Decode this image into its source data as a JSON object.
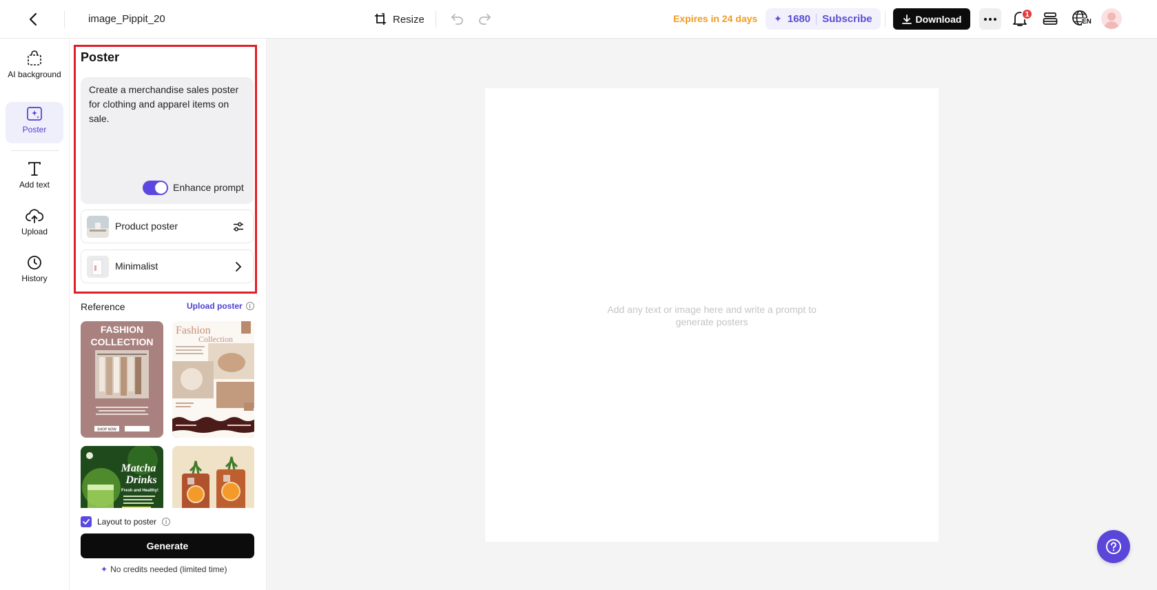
{
  "topbar": {
    "file_name": "image_Pippit_20",
    "resize_label": "Resize",
    "expires_text": "Expires in 24 days",
    "credits": "1680",
    "subscribe_label": "Subscribe",
    "download_label": "Download",
    "notification_count": "1",
    "language": "EN"
  },
  "rail": {
    "items": [
      {
        "label": "AI background",
        "icon": "bag-icon"
      },
      {
        "label": "Poster",
        "icon": "poster-icon"
      },
      {
        "label": "Add text",
        "icon": "text-icon"
      },
      {
        "label": "Upload",
        "icon": "cloud-upload-icon"
      },
      {
        "label": "History",
        "icon": "clock-icon"
      }
    ]
  },
  "panel": {
    "title": "Poster",
    "prompt_text": "Create a merchandise sales poster for clothing and apparel items on sale.",
    "enhance_label": "Enhance prompt",
    "enhance_on": true,
    "options": [
      {
        "label": "Product poster",
        "icon": "sliders-icon"
      },
      {
        "label": "Minimalist",
        "icon": "chevron-right-icon"
      }
    ],
    "reference_title": "Reference",
    "upload_poster_label": "Upload poster",
    "references": [
      {
        "title_line1": "FASHION",
        "title_line2": "COLLECTION",
        "btn1": "SHOP NOW"
      },
      {
        "title_line1": "Fashion",
        "title_line2": "Collection"
      },
      {
        "title_line1": "Matcha",
        "title_line2": "Drinks",
        "subtitle": "Fresh and Healthy!"
      },
      {
        "title_line1": "",
        "title_line2": ""
      }
    ],
    "layout_label": "Layout to poster",
    "layout_checked": true,
    "generate_label": "Generate",
    "no_credits_text": "No credits needed (limited time)"
  },
  "canvas": {
    "hint": "Add any text or image here and write a prompt to generate posters"
  },
  "colors": {
    "accent": "#5b48e0",
    "expires": "#f29a1f",
    "highlight": "#e01e2a"
  }
}
